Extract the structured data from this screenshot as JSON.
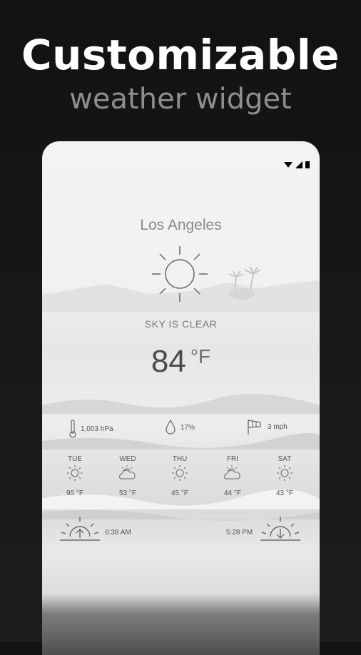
{
  "headline": "Customizable",
  "subheadline": "weather widget",
  "widget": {
    "city": "Los Angeles",
    "condition": "SKY IS CLEAR",
    "temperature": "84",
    "unit": "°F",
    "pressure": "1,003 hPa",
    "humidity": "17%",
    "wind": "3 mph",
    "forecast": [
      {
        "day": "TUE",
        "temp": "95 °F",
        "icon": "sun-icon"
      },
      {
        "day": "WED",
        "temp": "53 °F",
        "icon": "cloudy-sun-icon"
      },
      {
        "day": "THU",
        "temp": "45 °F",
        "icon": "sun-icon"
      },
      {
        "day": "FRI",
        "temp": "44 °F",
        "icon": "cloudy-sun-icon"
      },
      {
        "day": "SAT",
        "temp": "43 °F",
        "icon": "sun-icon"
      }
    ],
    "sunrise": "6:38 AM",
    "sunset": "5:28 PM"
  }
}
